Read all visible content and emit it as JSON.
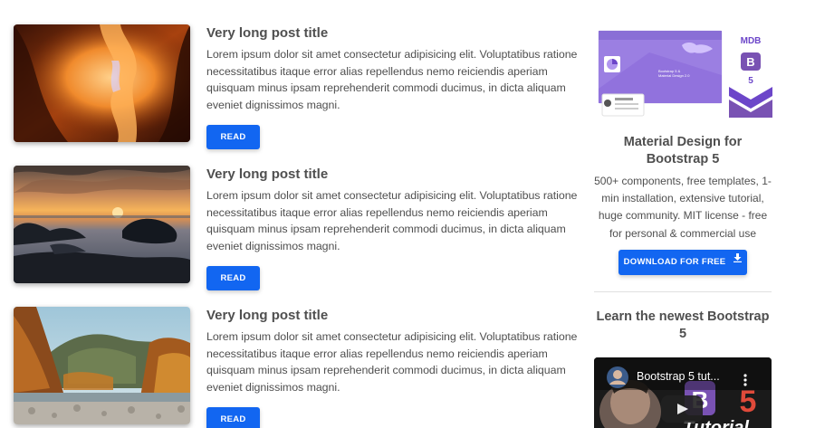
{
  "posts": [
    {
      "title": "Very long post title",
      "text": "Lorem ipsum dolor sit amet consectetur adipisicing elit. Voluptatibus ratione necessitatibus itaque error alias repellendus nemo reiciendis aperiam quisquam minus ipsam reprehenderit commodi ducimus, in dicta aliquam eveniet dignissimos magni.",
      "button": "READ",
      "image": "canyon-photo"
    },
    {
      "title": "Very long post title",
      "text": "Lorem ipsum dolor sit amet consectetur adipisicing elit. Voluptatibus ratione necessitatibus itaque error alias repellendus nemo reiciendis aperiam quisquam minus ipsam reprehenderit commodi ducimus, in dicta aliquam eveniet dignissimos magni.",
      "button": "READ",
      "image": "sunset-sea-photo"
    },
    {
      "title": "Very long post title",
      "text": "Lorem ipsum dolor sit amet consectetur adipisicing elit. Voluptatibus ratione necessitatibus itaque error alias repellendus nemo reiciendis aperiam quisquam minus ipsam reprehenderit commodi ducimus, in dicta aliquam eveniet dignissimos magni.",
      "button": "READ",
      "image": "autumn-mountain-photo"
    }
  ],
  "sidebar": {
    "logo_text": "MDB",
    "logo_letter": "B",
    "logo_version": "5",
    "promo_title": "Material Design for Bootstrap 5",
    "promo_text": "500+ components, free templates, 1-min installation, extensive tutorial, huge community. MIT license - free for personal & commercial use",
    "download_button": "DOWNLOAD FOR FREE",
    "download_icon": "download-icon",
    "learn_title": "Learn the newest Bootstrap 5",
    "video_title": "Bootstrap 5 tut...",
    "video_overlay_letter": "B",
    "video_overlay_number": "5",
    "video_overlay_text": "Tutorial"
  },
  "colors": {
    "primary": "#1266f1",
    "text": "#4f4f4f",
    "mdb_purple": "#7952b3"
  }
}
